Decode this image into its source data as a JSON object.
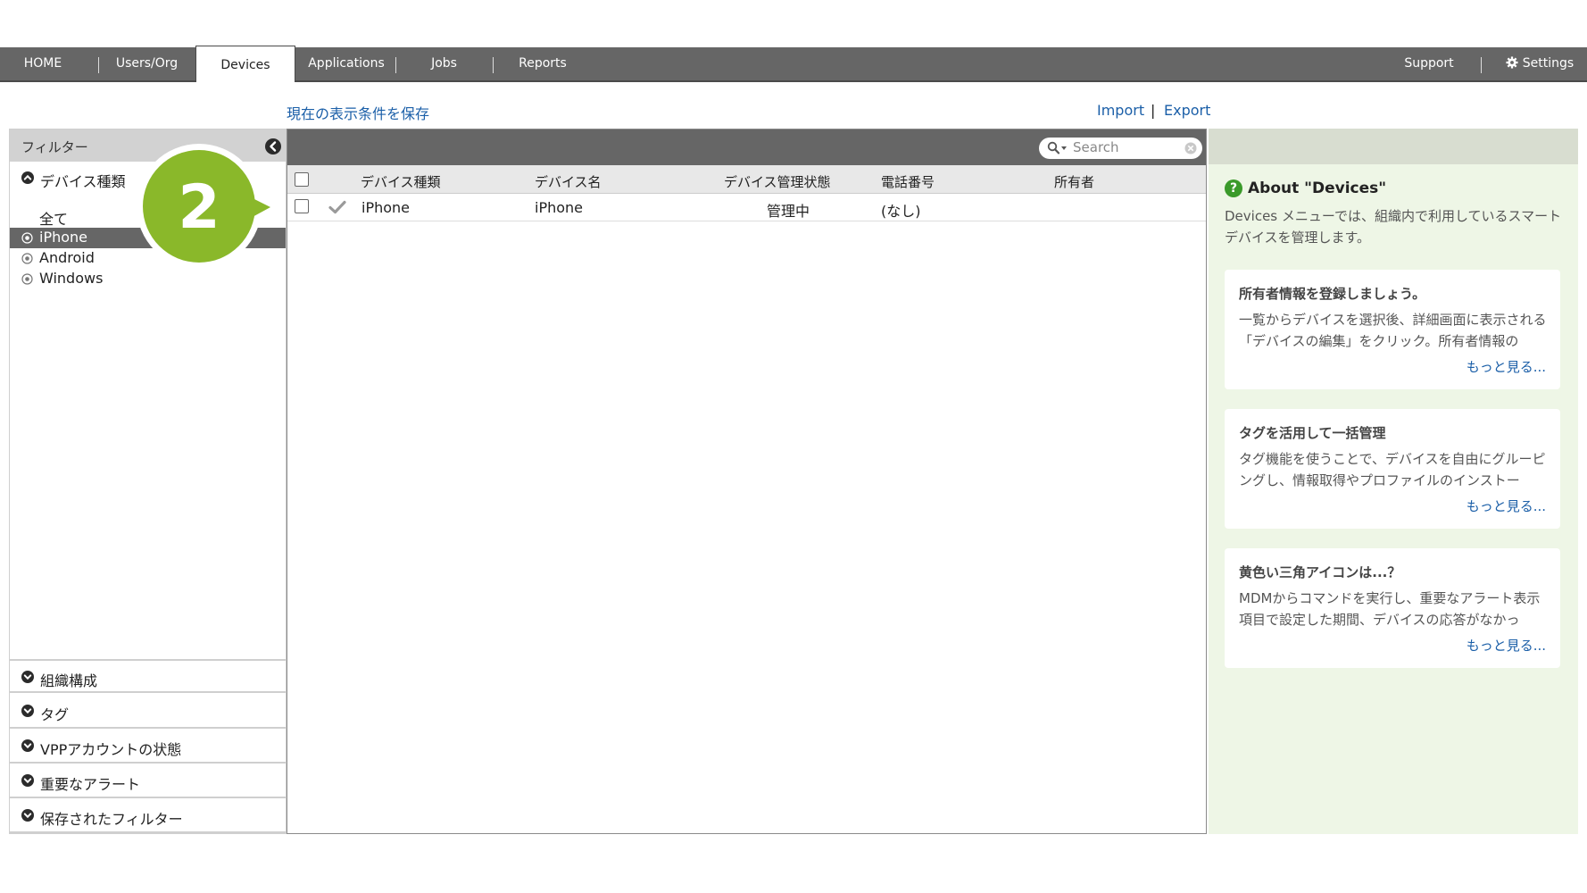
{
  "nav": {
    "tabs": [
      {
        "label": "HOME"
      },
      {
        "label": "Users/Org"
      },
      {
        "label": "Devices",
        "active": true
      },
      {
        "label": "Applications"
      },
      {
        "label": "Jobs"
      },
      {
        "label": "Reports"
      }
    ],
    "support": "Support",
    "settings": "Settings"
  },
  "linkbar": {
    "save_view": "現在の表示条件を保存",
    "import": "Import",
    "divider": "|",
    "export": "Export"
  },
  "sidebar": {
    "title": "フィルター",
    "device_type": {
      "label": "デバイス種類",
      "options": [
        {
          "label": "全て"
        },
        {
          "label": "iPhone",
          "selected": true
        },
        {
          "label": "Android"
        },
        {
          "label": "Windows"
        }
      ]
    },
    "sections": [
      {
        "label": "組織構成"
      },
      {
        "label": "タグ"
      },
      {
        "label": "VPPアカウントの状態"
      },
      {
        "label": "重要なアラート"
      },
      {
        "label": "保存されたフィルター"
      }
    ]
  },
  "search": {
    "placeholder": "Search"
  },
  "table": {
    "columns": [
      "デバイス種類",
      "デバイス名",
      "デバイス管理状態",
      "電話番号",
      "所有者"
    ],
    "rows": [
      {
        "type": "iPhone",
        "name": "iPhone",
        "status": "管理中",
        "phone": "(なし)",
        "owner": ""
      }
    ]
  },
  "about": {
    "title": "About \"Devices\"",
    "help_icon": "?",
    "description": "Devices メニューでは、組織内で利用しているスマートデバイスを管理します。",
    "cards": [
      {
        "title": "所有者情報を登録しましょう。",
        "body": "一覧からデバイスを選択後、詳細画面に表示される「デバイスの編集」をクリック。所有者情報の",
        "more": "もっと見る..."
      },
      {
        "title": "タグを活用して一括管理",
        "body": "タグ機能を使うことで、デバイスを自由にグルーピングし、情報取得やプロファイルのインストー",
        "more": "もっと見る..."
      },
      {
        "title": "黄色い三角アイコンは...？",
        "body": "MDMからコマンドを実行し、重要なアラート表示項目で設定した期間、デバイスの応答がなかっ",
        "more": "もっと見る..."
      }
    ]
  },
  "callout": {
    "number": "2"
  },
  "colors": {
    "nav": "#666666",
    "accent_green": "#8ab82a",
    "link": "#1b5fa8",
    "panel_bg": "#eef6e6"
  }
}
